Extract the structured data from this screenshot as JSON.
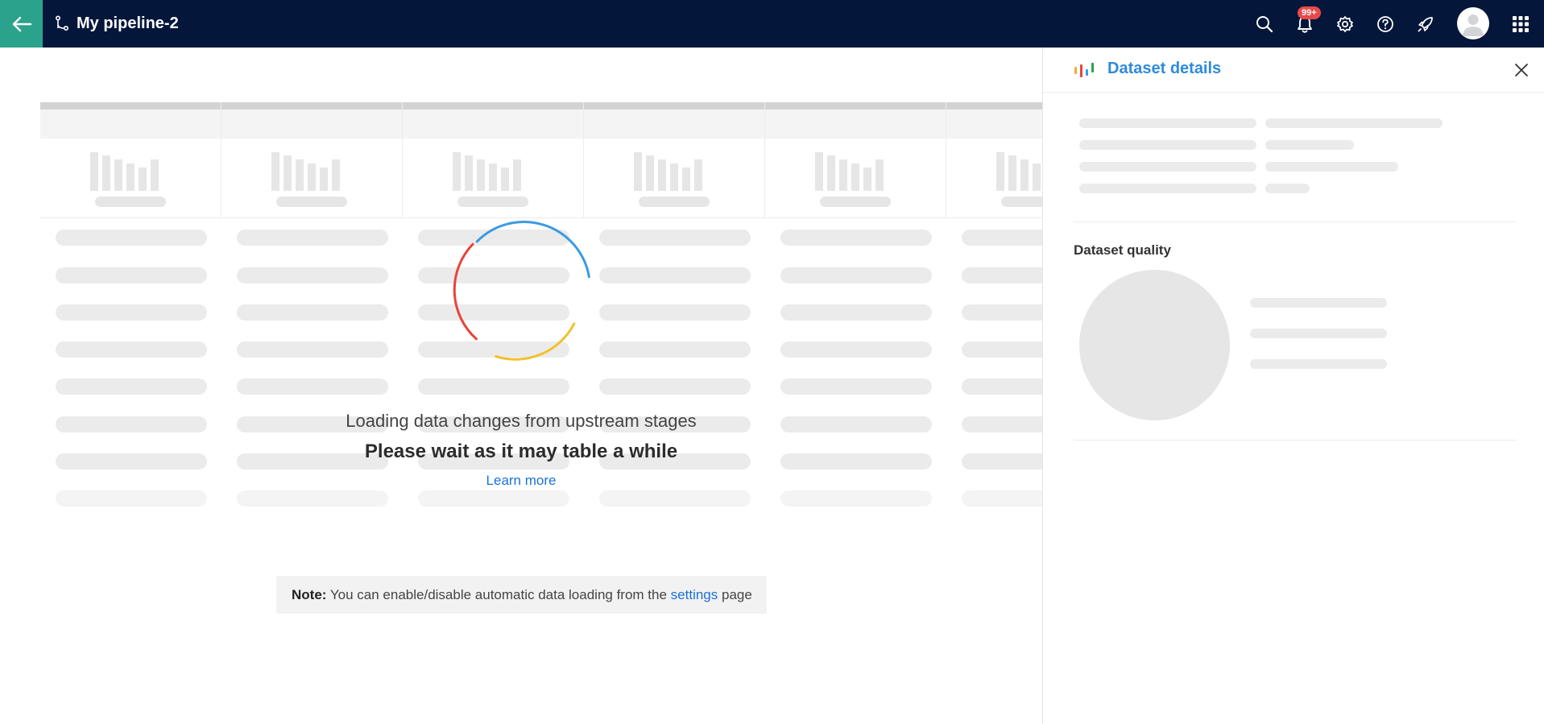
{
  "header": {
    "title": "My pipeline-2",
    "notification_badge": "99+",
    "icons": [
      "back-arrow-icon",
      "pipeline-icon",
      "search-icon",
      "bell-icon",
      "gear-icon",
      "help-icon",
      "rocket-icon",
      "avatar-user-icon",
      "app-grid-icon"
    ],
    "colors": {
      "bar": "#04163a",
      "back": "#2aa28c",
      "badge": "#e84a4a"
    }
  },
  "loader": {
    "line1": "Loading data changes from upstream stages",
    "line2": "Please wait as it may table a while",
    "learn_more": "Learn more",
    "spinner_colors": [
      "#3a9be0",
      "#e8433a",
      "#f2c02c"
    ]
  },
  "note": {
    "label": "Note:",
    "text_before": "You can enable/disable automatic data loading from the",
    "link": "settings",
    "text_after": "page"
  },
  "panel": {
    "title": "Dataset details",
    "quality_label": "Dataset quality",
    "icon": "dataset-chart-icon",
    "accent": "#2d8bdd"
  }
}
